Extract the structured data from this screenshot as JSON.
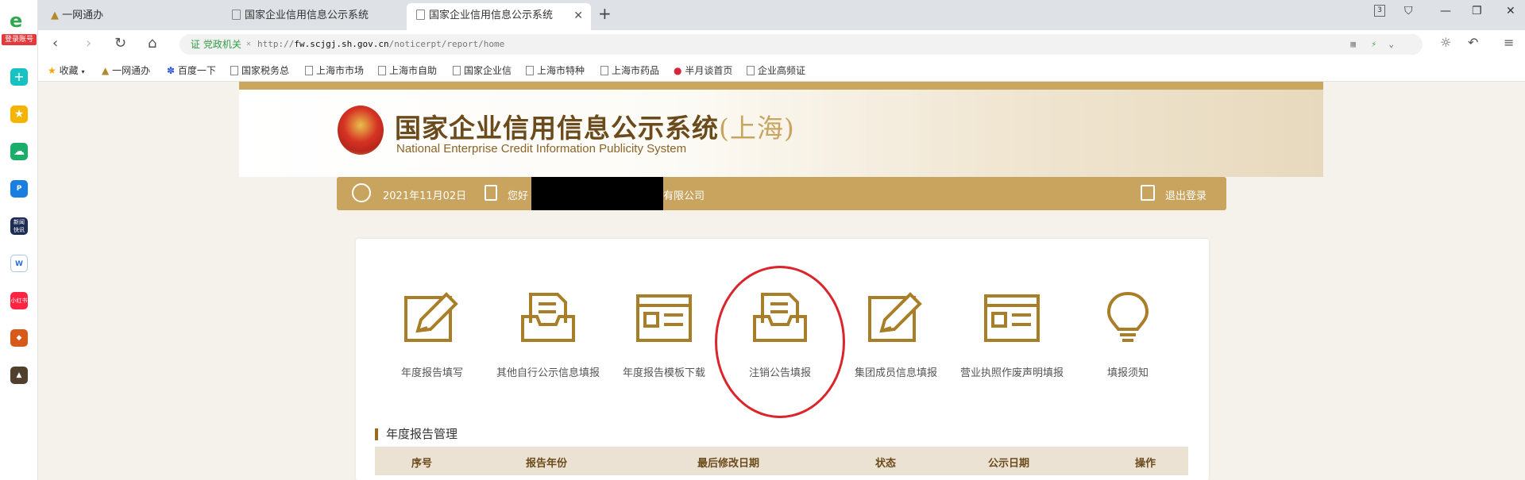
{
  "sidebar": {
    "login_badge": "登录账号",
    "app_icons": [
      "browser-logo-icon",
      "plus-app-icon",
      "star-app-icon",
      "cloud-app-icon",
      "p-app-icon",
      "news-app-icon",
      "word-app-icon",
      "xiaohongshu-app-icon",
      "game-app-icon",
      "game2-app-icon"
    ]
  },
  "tabs": [
    {
      "label": "一网通办",
      "active": false
    },
    {
      "label": "国家企业信用信息公示系统",
      "active": false
    },
    {
      "label": "国家企业信用信息公示系统",
      "active": true
    }
  ],
  "window": {
    "page_badge": "3"
  },
  "address": {
    "cert_label": "证 党政机关",
    "url_prefix": "http://",
    "url_host": "fw.scjgj.sh.gov.cn",
    "url_path": "/noticerpt/report/home"
  },
  "bookmarks": [
    "收藏",
    "一网通办",
    "百度一下",
    "国家税务总",
    "上海市市场",
    "上海市自助",
    "国家企业信",
    "上海市特种",
    "上海市药品",
    "半月谈首页",
    "企业高频证"
  ],
  "site": {
    "title": "国家企业信用信息公示系统",
    "region": "(上海)",
    "subtitle": "National Enterprise Credit Information Publicity System"
  },
  "info": {
    "date": "2021年11月02日",
    "greeting": "您好",
    "company_suffix": "有限公司",
    "logout": "退出登录"
  },
  "functions": [
    {
      "label": "年度报告填写",
      "icon": "edit-icon"
    },
    {
      "label": "其他自行公示信息填报",
      "icon": "inbox-doc-icon"
    },
    {
      "label": "年度报告模板下载",
      "icon": "template-icon"
    },
    {
      "label": "注销公告填报",
      "icon": "inbox-doc-icon",
      "highlighted": true
    },
    {
      "label": "集团成员信息填报",
      "icon": "edit-icon"
    },
    {
      "label": "营业执照作废声明填报",
      "icon": "template-icon"
    },
    {
      "label": "填报须知",
      "icon": "lightbulb-icon"
    }
  ],
  "report": {
    "section_title": "年度报告管理",
    "columns": [
      "序号",
      "报告年份",
      "最后修改日期",
      "状态",
      "公示日期",
      "操作"
    ]
  },
  "colors": {
    "gold": "#c9a45e",
    "dark_gold": "#9a6a1e",
    "highlight_red": "#d9252b"
  }
}
